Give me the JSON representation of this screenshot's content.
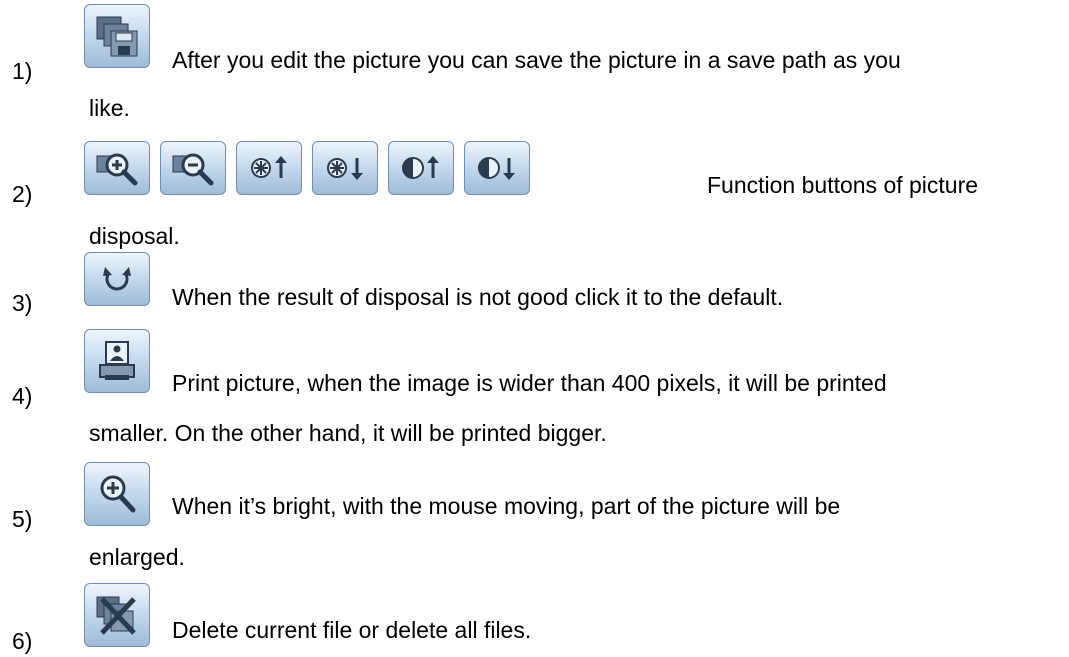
{
  "items": [
    {
      "number": "1)",
      "icons": [
        "save-icon"
      ],
      "text": "After you edit the picture you can save the picture in a save path as you",
      "text2": "like."
    },
    {
      "number": "2)",
      "icons": [
        "zoom-in-icon",
        "zoom-out-icon",
        "brightness-up-icon",
        "brightness-down-icon",
        "contrast-up-icon",
        "contrast-down-icon"
      ],
      "text": "Function buttons of picture",
      "text2": "disposal."
    },
    {
      "number": "3)",
      "icons": [
        "reset-icon"
      ],
      "text": "When the result of disposal is not good click it to the default.",
      "text2": ""
    },
    {
      "number": "4)",
      "icons": [
        "print-icon"
      ],
      "text": "Print picture, when the image is wider than 400 pixels, it will be printed",
      "text2": "smaller. On the other hand, it will be printed bigger."
    },
    {
      "number": "5)",
      "icons": [
        "magnifier-icon"
      ],
      "text": "When it’s bright, with the mouse moving, part of the picture will be",
      "text2": "enlarged."
    },
    {
      "number": "6)",
      "icons": [
        "delete-icon"
      ],
      "text": "Delete current file or delete all files.",
      "text2": ""
    }
  ]
}
